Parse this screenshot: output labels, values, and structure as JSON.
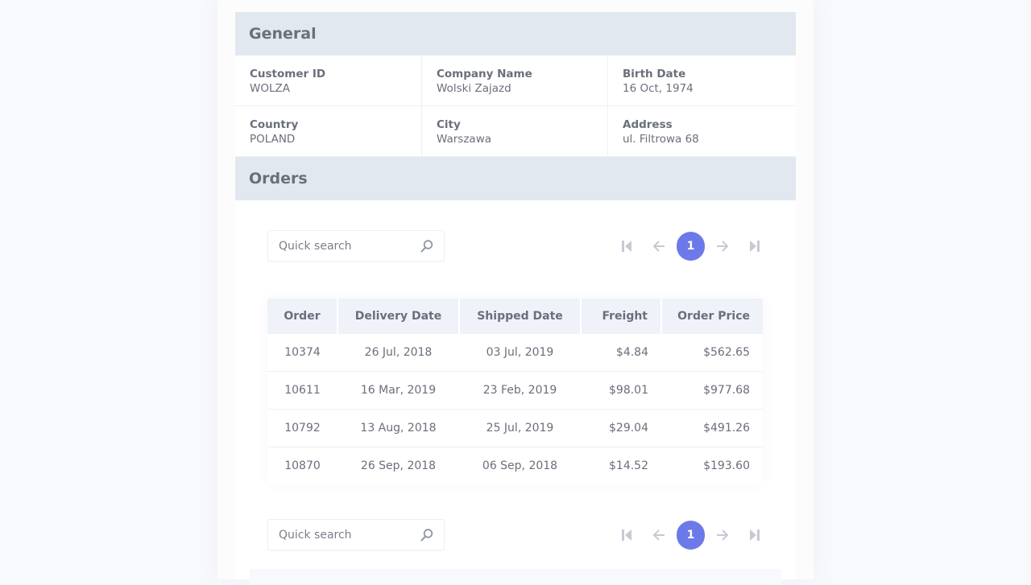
{
  "general": {
    "title": "General",
    "fields": [
      {
        "label": "Customer ID",
        "value": "WOLZA"
      },
      {
        "label": "Company Name",
        "value": "Wolski Zajazd"
      },
      {
        "label": "Birth Date",
        "value": "16 Oct, 1974"
      },
      {
        "label": "Country",
        "value": "POLAND"
      },
      {
        "label": "City",
        "value": "Warszawa"
      },
      {
        "label": "Address",
        "value": "ul. Filtrowa 68"
      }
    ]
  },
  "orders": {
    "title": "Orders",
    "search_placeholder": "Quick search",
    "search_value": "",
    "current_page": "1",
    "columns": [
      "Order",
      "Delivery Date",
      "Shipped Date",
      "Freight",
      "Order Price"
    ],
    "rows": [
      [
        "10374",
        "26 Jul, 2018",
        "03 Jul, 2019",
        "$4.84",
        "$562.65"
      ],
      [
        "10611",
        "16 Mar, 2019",
        "23 Feb, 2019",
        "$98.01",
        "$977.68"
      ],
      [
        "10792",
        "13 Aug, 2018",
        "25 Jul, 2019",
        "$29.04",
        "$491.26"
      ],
      [
        "10870",
        "26 Sep, 2018",
        "06 Sep, 2018",
        "$14.52",
        "$193.60"
      ]
    ]
  },
  "icons": {
    "search": "search-icon",
    "first": "first-page-icon",
    "prev": "arrow-left-icon",
    "next": "arrow-right-icon",
    "last": "last-page-icon"
  },
  "colors": {
    "accent": "#6c7ae9",
    "section_header_bg": "#e2e8f0",
    "table_header_bg": "#eff2f9",
    "text": "#6b6f7b",
    "pager_icon": "#c5cad3"
  }
}
